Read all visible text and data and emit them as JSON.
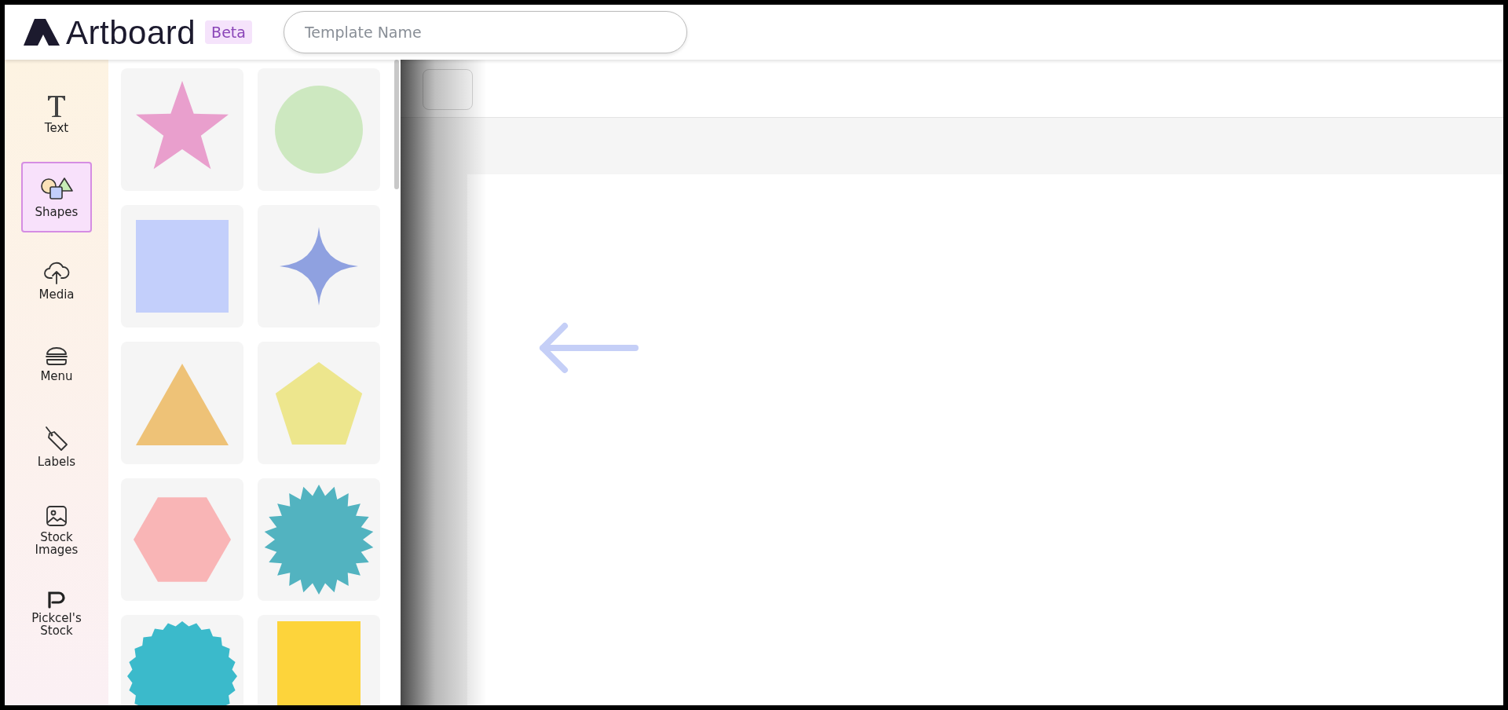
{
  "app": {
    "name": "Artboard",
    "badge": "Beta"
  },
  "template_name": {
    "placeholder": "Template Name"
  },
  "sidebar": {
    "items": [
      {
        "label": "Text",
        "kind": "text",
        "selected": false
      },
      {
        "label": "Shapes",
        "kind": "shapes",
        "selected": true
      },
      {
        "label": "Media",
        "kind": "media",
        "selected": false
      },
      {
        "label": "Menu",
        "kind": "menu",
        "selected": false
      },
      {
        "label": "Labels",
        "kind": "labels",
        "selected": false
      },
      {
        "label": "Stock Images",
        "kind": "images",
        "selected": false
      },
      {
        "label": "Pickcel's Stock",
        "kind": "stock",
        "selected": false
      }
    ]
  },
  "shapes": [
    {
      "kind": "star",
      "color": "#e99fcd"
    },
    {
      "kind": "circle",
      "color": "#cde8c0"
    },
    {
      "kind": "square",
      "color": "#c3cffb"
    },
    {
      "kind": "sparkle",
      "color": "#8fa1e0"
    },
    {
      "kind": "triangle",
      "color": "#eec277"
    },
    {
      "kind": "pentagon",
      "color": "#ede68d"
    },
    {
      "kind": "hexagon",
      "color": "#f9b5b6"
    },
    {
      "kind": "burst",
      "color": "#52b3c0"
    },
    {
      "kind": "scallop",
      "color": "#3bbacb"
    },
    {
      "kind": "rectangle",
      "color": "#fdd43b"
    }
  ]
}
